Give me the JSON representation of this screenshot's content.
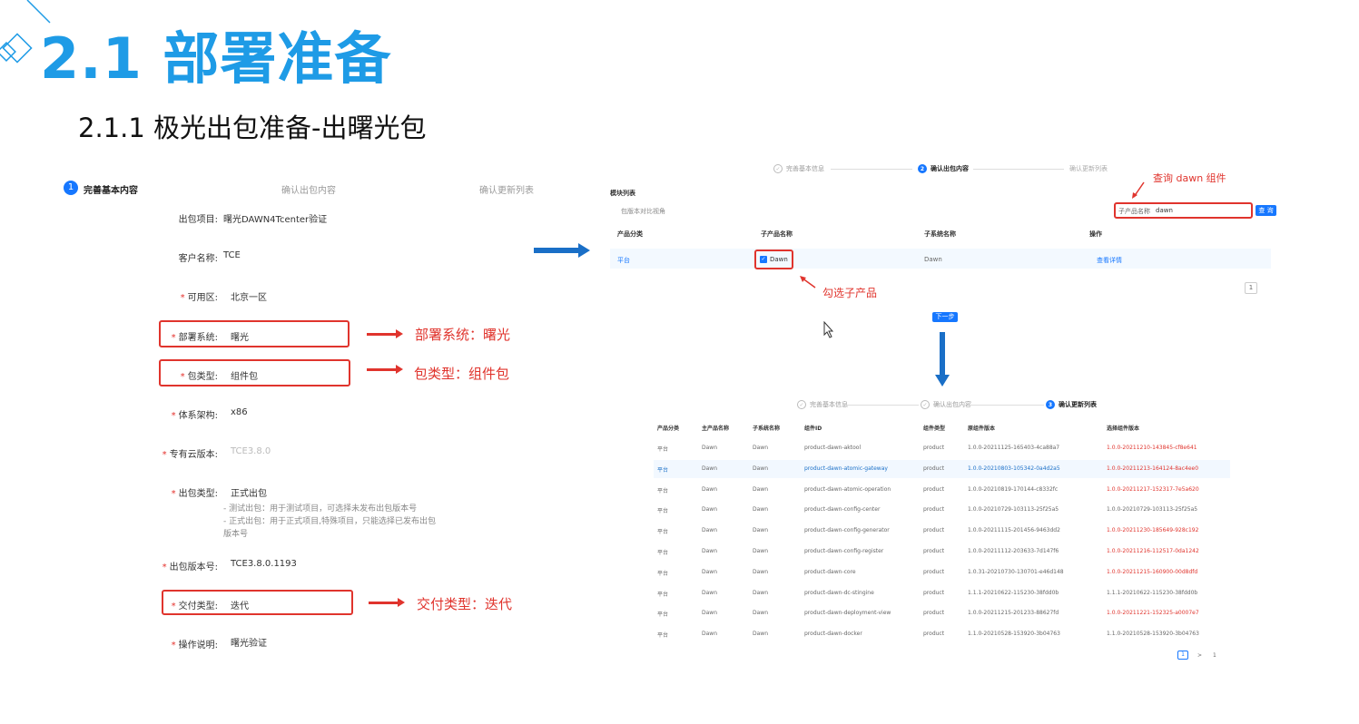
{
  "slide": {
    "title": "2.1 部署准备",
    "subtitle": "2.1.1 极光出包准备-出曙光包"
  },
  "left_form": {
    "steps": [
      {
        "num": "1",
        "label": "完善基本内容"
      },
      {
        "num": "",
        "label": "确认出包内容"
      },
      {
        "num": "",
        "label": "确认更新列表"
      }
    ],
    "fields": {
      "project": {
        "label": "出包项目:",
        "value": "曙光DAWN4Tcenter验证"
      },
      "customer": {
        "label": "客户名称:",
        "value": "TCE"
      },
      "zone": {
        "label": "可用区:",
        "value": "北京一区"
      },
      "deploy_system": {
        "label": "部署系统:",
        "value": "曙光"
      },
      "package_type": {
        "label": "包类型:",
        "value": "组件包"
      },
      "arch": {
        "label": "体系架构:",
        "value": "x86"
      },
      "cloud_version": {
        "label": "专有云版本:",
        "value": "TCE3.8.0"
      },
      "release_type": {
        "label": "出包类型:",
        "value": "正式出包"
      },
      "release_hint1": "- 测试出包：用于测试项目，可选择未发布出包版本号",
      "release_hint2": "- 正式出包：用于正式项目,特殊项目，只能选择已发布出包",
      "release_hint3": "版本号",
      "release_version": {
        "label": "出包版本号:",
        "value": "TCE3.8.0.1193"
      },
      "delivery_type": {
        "label": "交付类型:",
        "value": "迭代"
      },
      "op_desc": {
        "label": "操作说明:",
        "value": "曙光验证"
      }
    }
  },
  "annotations": {
    "deploy_system": "部署系统：曙光",
    "package_type": "包类型：组件包",
    "delivery_type": "交付类型：迭代",
    "query_dawn": "查询 dawn 组件",
    "check_sub": "勾选子产品"
  },
  "top_panel": {
    "steps": [
      "完善基本信息",
      "确认出包内容",
      "确认更新列表"
    ],
    "step2_num": "2",
    "section_title": "模块列表",
    "compare_view": "包版本对比视角",
    "search_label": "子产品名称",
    "search_value": "dawn",
    "search_button": "查 询",
    "headers": [
      "产品分类",
      "子产品名称",
      "子系统名称",
      "操作"
    ],
    "row": {
      "category": "平台",
      "sub_product": "Dawn",
      "sub_system": "Dawn",
      "action": "查看详情"
    },
    "page": "1",
    "next_button": "下一步"
  },
  "bottom_panel": {
    "steps": [
      "完善基本信息",
      "确认出包内容",
      "确认更新列表"
    ],
    "step3_num": "3",
    "headers": [
      "产品分类",
      "主产品名称",
      "子系统名称",
      "组件ID",
      "组件类型",
      "原组件版本",
      "选择组件版本"
    ],
    "rows": [
      [
        "平台",
        "Dawn",
        "Dawn",
        "product-dawn-aktool",
        "product",
        "1.0.0-20211125-165403-4ca88a7",
        "1.0.0-20211210-143845-cf8e641"
      ],
      [
        "平台",
        "Dawn",
        "Dawn",
        "product-dawn-atomic-gateway",
        "product",
        "1.0.0-20210803-105342-0a4d2a5",
        "1.0.0-20211213-164124-8ac4ee0"
      ],
      [
        "平台",
        "Dawn",
        "Dawn",
        "product-dawn-atomic-operation",
        "product",
        "1.0.0-20210819-170144-c8332fc",
        "1.0.0-20211217-152317-7e5a620"
      ],
      [
        "平台",
        "Dawn",
        "Dawn",
        "product-dawn-config-center",
        "product",
        "1.0.0-20210729-103113-25f25a5",
        "1.0.0-20210729-103113-25f25a5"
      ],
      [
        "平台",
        "Dawn",
        "Dawn",
        "product-dawn-config-generator",
        "product",
        "1.0.0-20211115-201456-9463dd2",
        "1.0.0-20211230-185649-928c192"
      ],
      [
        "平台",
        "Dawn",
        "Dawn",
        "product-dawn-config-register",
        "product",
        "1.0.0-20211112-203633-7d147f6",
        "1.0.0-20211216-112517-0da1242"
      ],
      [
        "平台",
        "Dawn",
        "Dawn",
        "product-dawn-core",
        "product",
        "1.0.31-20210730-130701-e46d148",
        "1.0.0-20211215-160900-00d8dfd"
      ],
      [
        "平台",
        "Dawn",
        "Dawn",
        "product-dawn-dc-stingine",
        "product",
        "1.1.1-20210622-115230-38fdd0b",
        "1.1.1-20210622-115230-38fdd0b"
      ],
      [
        "平台",
        "Dawn",
        "Dawn",
        "product-dawn-deployment-view",
        "product",
        "1.0.0-20211215-201233-88627fd",
        "1.0.0-20211221-152325-a0007e7"
      ],
      [
        "平台",
        "Dawn",
        "Dawn",
        "product-dawn-docker",
        "product",
        "1.1.0-20210528-153920-3b04763",
        "1.1.0-20210528-153920-3b04763"
      ]
    ],
    "pager": [
      "1",
      ">",
      "1"
    ]
  },
  "colors": {
    "accent": "#1e9be6",
    "primary": "#1677ff",
    "annotation": "#e0342d",
    "arrow": "#1a6fc7"
  },
  "icons": [
    "check-icon",
    "cursor-icon",
    "arrow-right-icon",
    "arrow-down-icon"
  ]
}
